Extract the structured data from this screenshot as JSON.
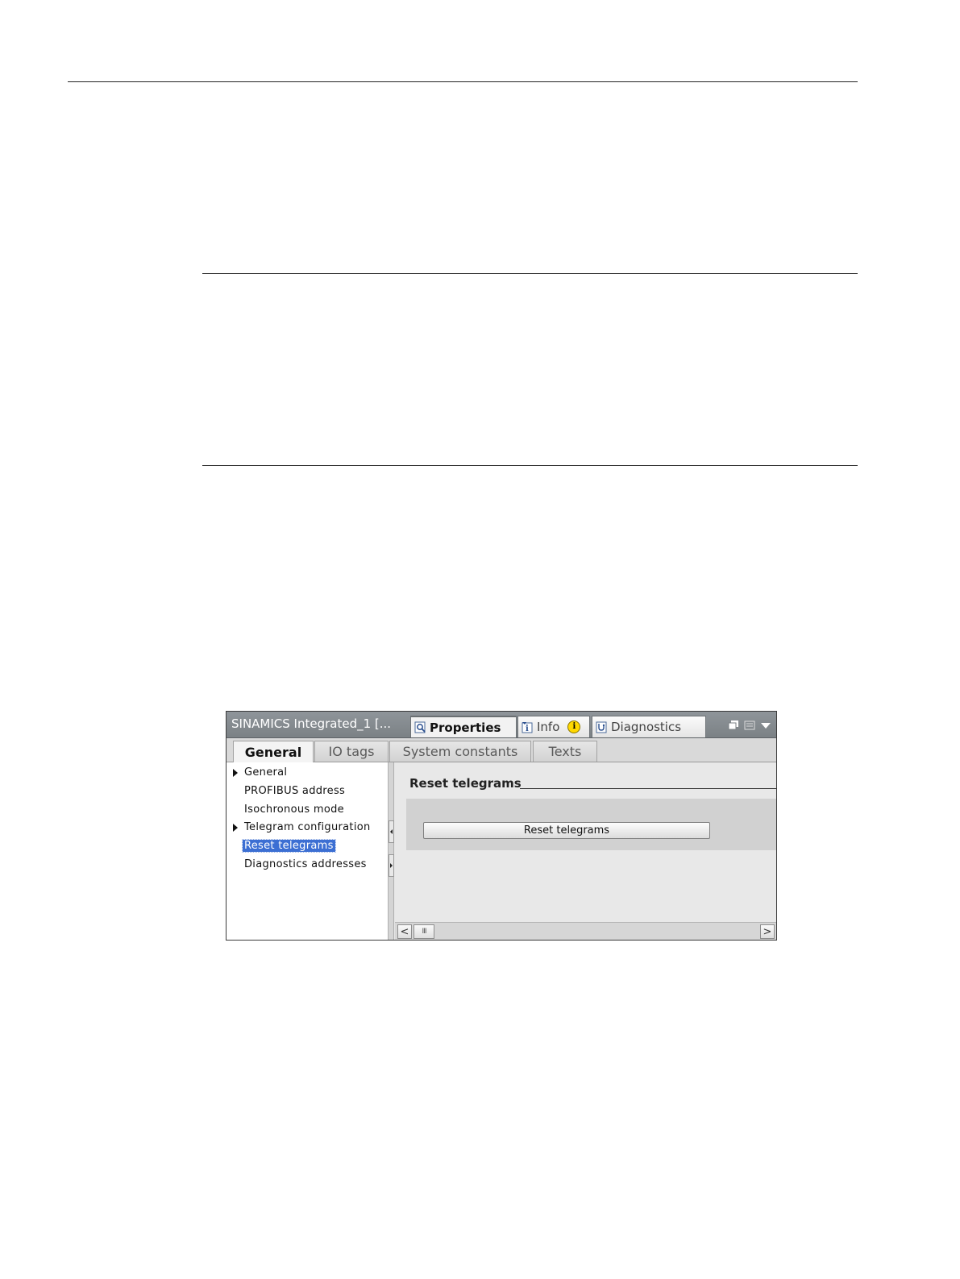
{
  "panel": {
    "title": "SINAMICS  Integrated_1  [...",
    "top_tabs": [
      {
        "label": "Properties",
        "icon": "properties-icon"
      },
      {
        "label": "Info",
        "icon": "info-icon",
        "badge": "i"
      },
      {
        "label": "Diagnostics",
        "icon": "diagnostics-icon"
      }
    ],
    "window_icons": [
      "restore-icon",
      "list-icon",
      "dropdown-icon"
    ]
  },
  "tabs": [
    {
      "label": "General",
      "active": true
    },
    {
      "label": "IO tags",
      "active": false
    },
    {
      "label": "System constants",
      "active": false
    },
    {
      "label": "Texts",
      "active": false
    }
  ],
  "nav": {
    "items": [
      {
        "label": "General",
        "expandable": true
      },
      {
        "label": "PROFIBUS address",
        "expandable": false
      },
      {
        "label": "Isochronous mode",
        "expandable": false
      },
      {
        "label": "Telegram configuration",
        "expandable": true
      },
      {
        "label": "Reset telegrams",
        "expandable": false,
        "selected": true
      },
      {
        "label": "Diagnostics addresses",
        "expandable": false
      }
    ]
  },
  "content": {
    "section_title": "Reset telegrams",
    "button_label": "Reset telegrams"
  },
  "scrollbar": {
    "left": "<",
    "right": ">",
    "thumb": "III"
  },
  "colors": {
    "titlebar": "#858b8f",
    "selection": "#3c6fd3",
    "badge": "#ffd800"
  }
}
